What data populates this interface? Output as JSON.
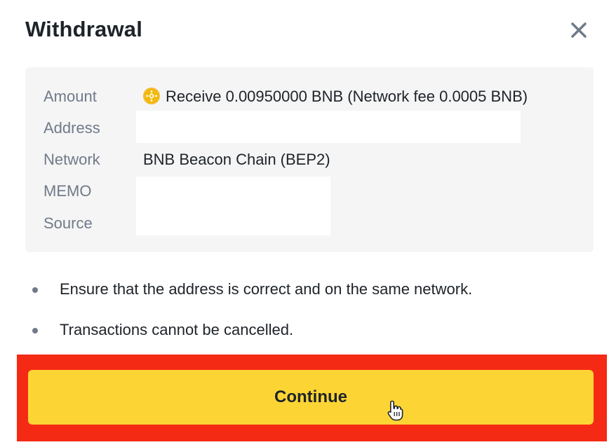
{
  "dialog": {
    "title": "Withdrawal"
  },
  "details": {
    "amount_label": "Amount",
    "amount_value": "Receive 0.00950000 BNB (Network fee 0.0005 BNB)",
    "coin_icon": "bnb-coin-icon",
    "address_label": "Address",
    "address_value": "",
    "network_label": "Network",
    "network_value": "BNB Beacon Chain (BEP2)",
    "memo_label": "MEMO",
    "memo_value": "",
    "source_label": "Source",
    "source_value": ""
  },
  "notices": [
    "Ensure that the address is correct and on the same network.",
    "Transactions cannot be cancelled."
  ],
  "actions": {
    "continue_label": "Continue"
  },
  "colors": {
    "accent": "#fcd535",
    "highlight": "#f52a14",
    "text": "#1e2329",
    "muted": "#707a8a",
    "panel": "#f5f5f5"
  }
}
